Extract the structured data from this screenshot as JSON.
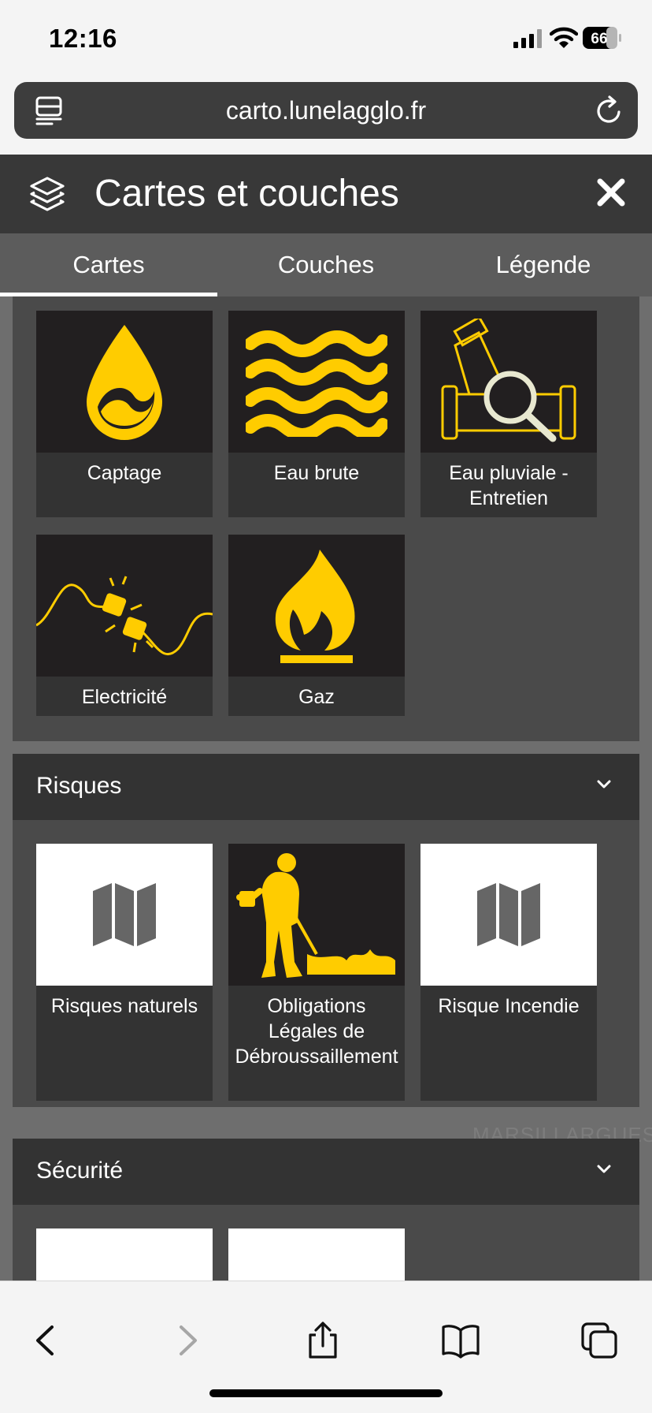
{
  "status_bar": {
    "time": "12:16",
    "battery": "66"
  },
  "browser": {
    "url": "carto.lunelagglo.fr"
  },
  "panel": {
    "title": "Cartes et couches"
  },
  "tabs": [
    {
      "label": "Cartes",
      "active": true
    },
    {
      "label": "Couches",
      "active": false
    },
    {
      "label": "Légende",
      "active": false
    }
  ],
  "network_cards": [
    {
      "label": "Captage",
      "icon": "water-drop-icon"
    },
    {
      "label": "Eau brute",
      "icon": "waves-icon"
    },
    {
      "label": "Eau pluviale - Entretien",
      "icon": "pipe-inspection-icon"
    },
    {
      "label": "Electricité",
      "icon": "electric-plug-icon"
    },
    {
      "label": "Gaz",
      "icon": "gas-flame-icon"
    }
  ],
  "sections": [
    {
      "name": "Risques",
      "cards": [
        {
          "label": "Risques naturels",
          "icon": "map-icon"
        },
        {
          "label": "Obligations Légales de Débroussaillement",
          "icon": "brush-cutter-icon"
        },
        {
          "label": "Risque Incendie",
          "icon": "map-icon"
        }
      ]
    },
    {
      "name": "Sécurité",
      "cards": [
        {
          "label": "",
          "icon": "map-icon"
        },
        {
          "label": "",
          "icon": "map-icon"
        }
      ]
    }
  ],
  "map_background_label": "MARSILLARGUES",
  "colors": {
    "accent": "#ffcc00",
    "panel_dark": "#383838",
    "tile_dark": "#221f20"
  }
}
